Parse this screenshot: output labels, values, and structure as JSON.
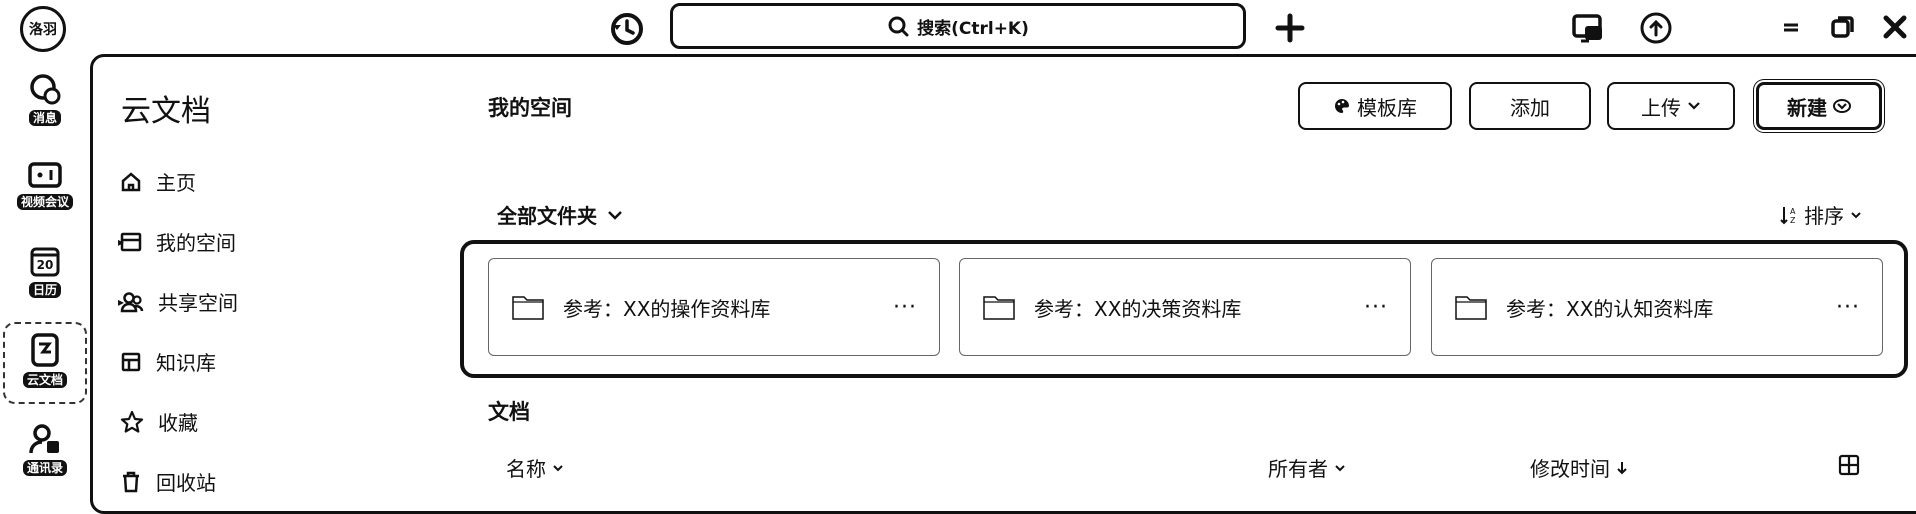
{
  "topbar": {
    "avatar_text": "洛羽",
    "search_placeholder": "搜索(Ctrl+K)",
    "icons": [
      "history-icon",
      "search-icon",
      "add-icon",
      "screen-share-icon",
      "upload-cloud-icon",
      "minimize-icon",
      "restore-icon",
      "close-icon"
    ]
  },
  "rail": {
    "items": [
      {
        "label": "消息",
        "icon": "chat-icon"
      },
      {
        "label": "视频会议",
        "icon": "video-icon"
      },
      {
        "label": "日历",
        "icon": "calendar-icon",
        "day": "20"
      },
      {
        "label": "云文档",
        "icon": "doc-icon"
      },
      {
        "label": "通讯录",
        "icon": "contacts-icon"
      }
    ]
  },
  "sidebar": {
    "title": "云文档",
    "items": [
      {
        "label": "主页",
        "icon": "home-icon"
      },
      {
        "label": "我的空间",
        "icon": "folder-icon"
      },
      {
        "label": "共享空间",
        "icon": "group-icon"
      },
      {
        "label": "知识库",
        "icon": "book-icon"
      },
      {
        "label": "收藏",
        "icon": "star-icon"
      },
      {
        "label": "回收站",
        "icon": "trash-icon"
      }
    ]
  },
  "main": {
    "title": "我的空间",
    "buttons": {
      "template": "模板库",
      "add": "添加",
      "upload": "上传",
      "new": "新建"
    },
    "folders_header": "全部文件夹",
    "sort_label": "排序",
    "folders": [
      {
        "name": "参考：XX的操作资料库"
      },
      {
        "name": "参考：XX的决策资料库"
      },
      {
        "name": "参考：XX的认知资料库"
      }
    ],
    "docs_title": "文档",
    "columns": {
      "name": "名称",
      "owner": "所有者",
      "modified": "修改时间"
    }
  }
}
